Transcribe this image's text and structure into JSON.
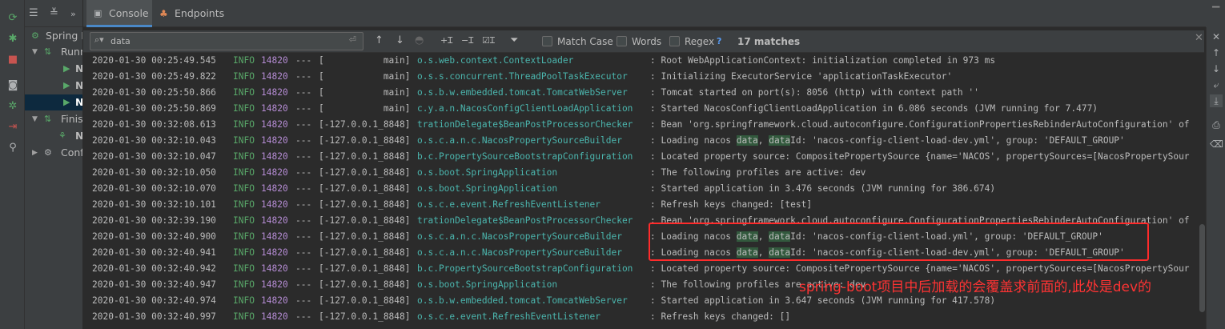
{
  "tabs": {
    "console": "Console",
    "endpoints": "Endpoints"
  },
  "tree": {
    "items": [
      {
        "label": "Spring B",
        "arrow": ""
      },
      {
        "label": "Runn",
        "arrow": "▼"
      },
      {
        "label": "N",
        "arrow": ""
      },
      {
        "label": "N",
        "arrow": ""
      },
      {
        "label": "N",
        "arrow": ""
      },
      {
        "label": "Finis",
        "arrow": "▼"
      },
      {
        "label": "N",
        "arrow": ""
      },
      {
        "label": "Confi",
        "arrow": "▶"
      }
    ]
  },
  "search": {
    "query": "data",
    "match_case": "Match Case",
    "words": "Words",
    "regex": "Regex",
    "help": "?",
    "matches": "17 matches"
  },
  "log": [
    {
      "ts": "2020-01-30 00:25:49.545",
      "level": "INFO",
      "pid": "14820",
      "sep": "---",
      "thread": "[           main]",
      "logger": "o.s.web.context.ContextLoader",
      "msg": [
        {
          "t": ": Root WebApplicationContext: initialization completed in 973 ms"
        }
      ]
    },
    {
      "ts": "2020-01-30 00:25:49.822",
      "level": "INFO",
      "pid": "14820",
      "sep": "---",
      "thread": "[           main]",
      "logger": "o.s.s.concurrent.ThreadPoolTaskExecutor",
      "msg": [
        {
          "t": ": Initializing ExecutorService 'applicationTaskExecutor'"
        }
      ]
    },
    {
      "ts": "2020-01-30 00:25:50.866",
      "level": "INFO",
      "pid": "14820",
      "sep": "---",
      "thread": "[           main]",
      "logger": "o.s.b.w.embedded.tomcat.TomcatWebServer",
      "msg": [
        {
          "t": ": Tomcat started on port(s): 8056 (http) with context path ''"
        }
      ]
    },
    {
      "ts": "2020-01-30 00:25:50.869",
      "level": "INFO",
      "pid": "14820",
      "sep": "---",
      "thread": "[           main]",
      "logger": "c.y.a.n.NacosConfigClientLoadApplication",
      "msg": [
        {
          "t": ": Started NacosConfigClientLoadApplication in 6.086 seconds (JVM running for 7.477)"
        }
      ]
    },
    {
      "ts": "2020-01-30 00:32:08.613",
      "level": "INFO",
      "pid": "14820",
      "sep": "---",
      "thread": "[-127.0.0.1_8848]",
      "logger": "trationDelegate$BeanPostProcessorChecker",
      "msg": [
        {
          "t": ": Bean 'org.springframework.cloud.autoconfigure.ConfigurationPropertiesRebinderAutoConfiguration' of"
        }
      ]
    },
    {
      "ts": "2020-01-30 00:32:10.043",
      "level": "INFO",
      "pid": "14820",
      "sep": "---",
      "thread": "[-127.0.0.1_8848]",
      "logger": "o.s.c.a.n.c.NacosPropertySourceBuilder",
      "msg": [
        {
          "t": ": Loading nacos "
        },
        {
          "t": "data",
          "h": true
        },
        {
          "t": ", "
        },
        {
          "t": "data",
          "h": true
        },
        {
          "t": "Id: 'nacos-config-client-load-dev.yml', group: 'DEFAULT_GROUP'"
        }
      ]
    },
    {
      "ts": "2020-01-30 00:32:10.047",
      "level": "INFO",
      "pid": "14820",
      "sep": "---",
      "thread": "[-127.0.0.1_8848]",
      "logger": "b.c.PropertySourceBootstrapConfiguration",
      "msg": [
        {
          "t": ": Located property source: CompositePropertySource {name='NACOS', propertySources=[NacosPropertySour"
        }
      ]
    },
    {
      "ts": "2020-01-30 00:32:10.050",
      "level": "INFO",
      "pid": "14820",
      "sep": "---",
      "thread": "[-127.0.0.1_8848]",
      "logger": "o.s.boot.SpringApplication",
      "msg": [
        {
          "t": ": The following profiles are active: dev"
        }
      ]
    },
    {
      "ts": "2020-01-30 00:32:10.070",
      "level": "INFO",
      "pid": "14820",
      "sep": "---",
      "thread": "[-127.0.0.1_8848]",
      "logger": "o.s.boot.SpringApplication",
      "msg": [
        {
          "t": ": Started application in 3.476 seconds (JVM running for 386.674)"
        }
      ]
    },
    {
      "ts": "2020-01-30 00:32:10.101",
      "level": "INFO",
      "pid": "14820",
      "sep": "---",
      "thread": "[-127.0.0.1_8848]",
      "logger": "o.s.c.e.event.RefreshEventListener",
      "msg": [
        {
          "t": ": Refresh keys changed: [test]"
        }
      ]
    },
    {
      "ts": "2020-01-30 00:32:39.190",
      "level": "INFO",
      "pid": "14820",
      "sep": "---",
      "thread": "[-127.0.0.1_8848]",
      "logger": "trationDelegate$BeanPostProcessorChecker",
      "msg": [
        {
          "t": ": Bean 'org.springframework.cloud.autoconfigure.ConfigurationPropertiesRebinderAutoConfiguration' of"
        }
      ]
    },
    {
      "ts": "2020-01-30 00:32:40.900",
      "level": "INFO",
      "pid": "14820",
      "sep": "---",
      "thread": "[-127.0.0.1_8848]",
      "logger": "o.s.c.a.n.c.NacosPropertySourceBuilder",
      "msg": [
        {
          "t": ": Loading nacos "
        },
        {
          "t": "data",
          "h": true
        },
        {
          "t": ", "
        },
        {
          "t": "data",
          "h": true
        },
        {
          "t": "Id: 'nacos-config-client-load.yml', group: 'DEFAULT_GROUP'"
        }
      ]
    },
    {
      "ts": "2020-01-30 00:32:40.941",
      "level": "INFO",
      "pid": "14820",
      "sep": "---",
      "thread": "[-127.0.0.1_8848]",
      "logger": "o.s.c.a.n.c.NacosPropertySourceBuilder",
      "msg": [
        {
          "t": ": Loading nacos "
        },
        {
          "t": "data",
          "h": true
        },
        {
          "t": ", "
        },
        {
          "t": "data",
          "h": true
        },
        {
          "t": "Id: 'nacos-config-client-load-dev.yml', group: 'DEFAULT_GROUP'"
        }
      ]
    },
    {
      "ts": "2020-01-30 00:32:40.942",
      "level": "INFO",
      "pid": "14820",
      "sep": "---",
      "thread": "[-127.0.0.1_8848]",
      "logger": "b.c.PropertySourceBootstrapConfiguration",
      "msg": [
        {
          "t": ": Located property source: CompositePropertySource {name='NACOS', propertySources=[NacosPropertySour"
        }
      ]
    },
    {
      "ts": "2020-01-30 00:32:40.947",
      "level": "INFO",
      "pid": "14820",
      "sep": "---",
      "thread": "[-127.0.0.1_8848]",
      "logger": "o.s.boot.SpringApplication",
      "msg": [
        {
          "t": ": The following profiles are active: dev"
        }
      ]
    },
    {
      "ts": "2020-01-30 00:32:40.974",
      "level": "INFO",
      "pid": "14820",
      "sep": "---",
      "thread": "[-127.0.0.1_8848]",
      "logger": "o.s.b.w.embedded.tomcat.TomcatWebServer",
      "msg": [
        {
          "t": ": Started application in 3.647 seconds (JVM running for 417.578)"
        }
      ]
    },
    {
      "ts": "2020-01-30 00:32:40.997",
      "level": "INFO",
      "pid": "14820",
      "sep": "---",
      "thread": "[-127.0.0.1_8848]",
      "logger": "o.s.c.e.event.RefreshEventListener",
      "msg": [
        {
          "t": ": Refresh keys changed: []"
        }
      ]
    }
  ],
  "annotation": "spring-boot项目中后加载的会覆盖求前面的,此处是dev的",
  "colors": {
    "level": "#59a869",
    "pid": "#b58cd4",
    "logger": "#4bb6ae",
    "match_highlight": "#32593d",
    "annotation": "#ff3333"
  }
}
